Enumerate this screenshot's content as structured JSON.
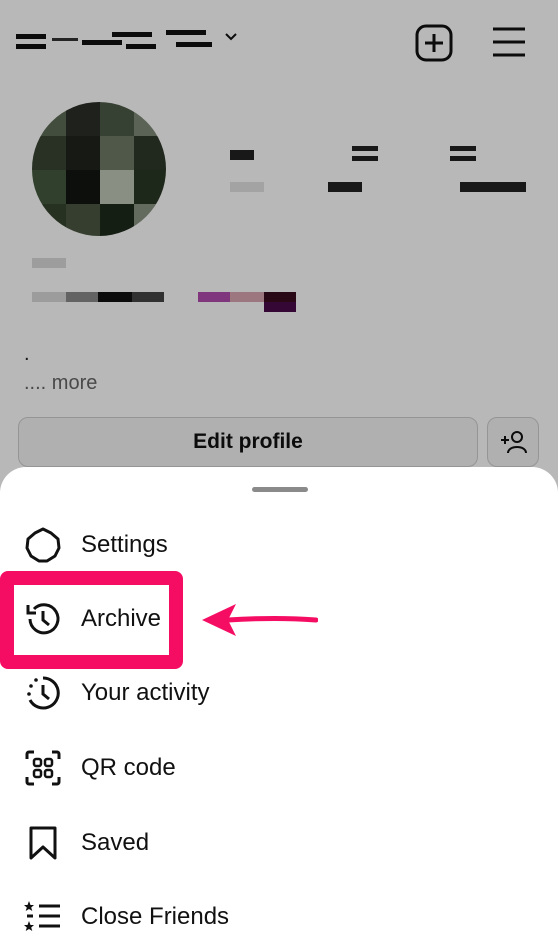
{
  "header": {
    "new_post_icon": "plus-square-icon",
    "menu_icon": "hamburger-menu-icon"
  },
  "profile": {
    "bio_dot": ".",
    "more_prefix": "....",
    "more_label": "more",
    "edit_profile_label": "Edit profile"
  },
  "sheet": {
    "items": [
      {
        "label": "Settings",
        "icon": "settings-gear-icon"
      },
      {
        "label": "Archive",
        "icon": "archive-history-icon"
      },
      {
        "label": "Your activity",
        "icon": "activity-clock-icon"
      },
      {
        "label": "QR code",
        "icon": "qr-code-icon"
      },
      {
        "label": "Saved",
        "icon": "bookmark-icon"
      },
      {
        "label": "Close Friends",
        "icon": "close-friends-list-icon"
      }
    ]
  },
  "annotation": {
    "highlight_color": "#f50d63"
  }
}
